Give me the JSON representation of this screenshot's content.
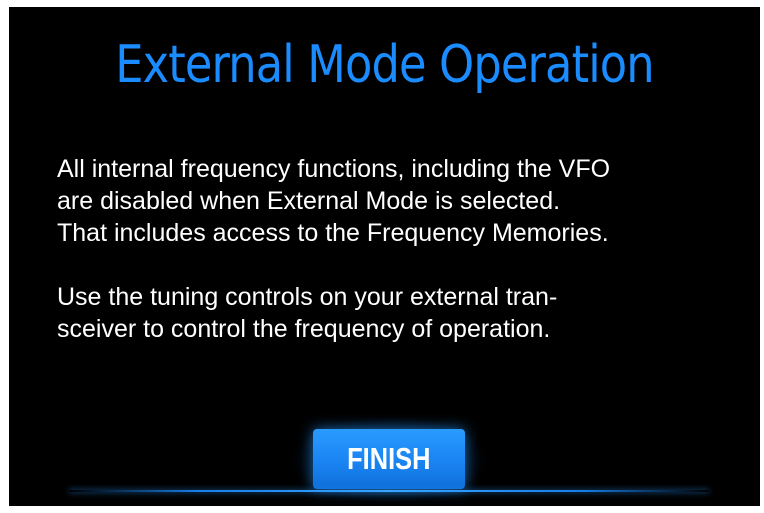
{
  "screen": {
    "title": "External Mode Operation",
    "paragraphs": [
      {
        "lines": [
          "All internal frequency functions, including the VFO",
          "are disabled when External Mode is selected.",
          "That includes access to the Frequency Memories."
        ]
      },
      {
        "lines": [
          "Use the tuning controls on your external tran-",
          "sceiver to control the frequency of operation."
        ]
      }
    ],
    "finish_label": "FINISH"
  },
  "colors": {
    "title": "#1a8cff",
    "background": "#000000",
    "text": "#ffffff",
    "button": "#1a84f2"
  }
}
